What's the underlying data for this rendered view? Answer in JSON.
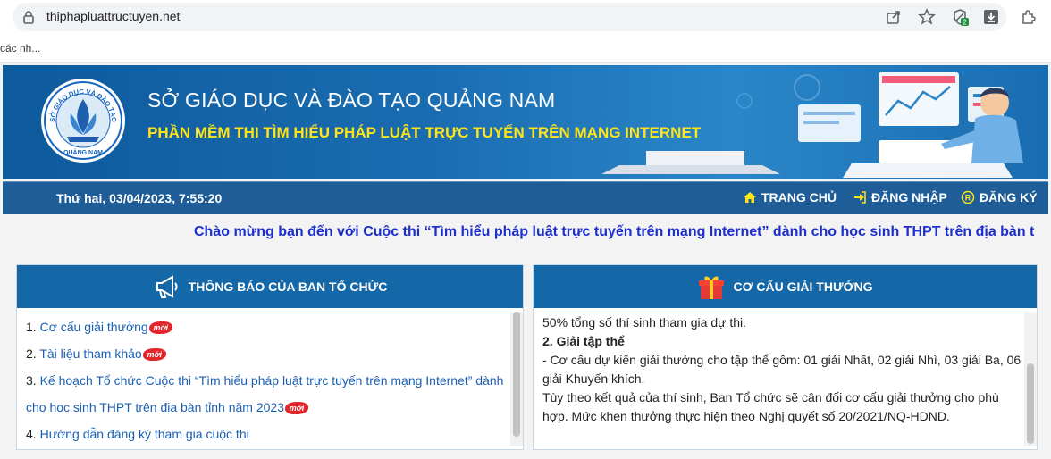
{
  "browser": {
    "url": "thiphapluattructuyen.net",
    "bookmark": "các nh...",
    "extension_badge": "2"
  },
  "header": {
    "org_title": "SỞ GIÁO DỤC VÀ ĐÀO TẠO QUẢNG NAM",
    "app_title": "PHẦN MỀM THI TÌM HIỂU PHÁP LUẬT TRỰC TUYẾN TRÊN MẠNG INTERNET",
    "logo_top": "SỞ GIÁO DỤC VÀ ĐÀO TẠO",
    "logo_bottom": "QUẢNG NAM"
  },
  "nav": {
    "datetime": "Thứ hai, 03/04/2023, 7:55:20",
    "home": "TRANG CHỦ",
    "login": "ĐĂNG NHẬP",
    "register": "ĐĂNG KÝ"
  },
  "marquee": "Chào mừng bạn đến với Cuộc thi “Tìm hiểu pháp luật trực tuyến trên mạng Internet” dành cho học sinh THPT trên địa bàn t",
  "notices": {
    "title": "THÔNG BÁO CỦA BAN TỔ CHỨC",
    "new_label": "mới",
    "items": [
      {
        "num": "1. ",
        "text": "Cơ cấu giải thưởng"
      },
      {
        "num": "2. ",
        "text": "Tài liệu tham khảo"
      },
      {
        "num": "3. ",
        "text": "Kế hoạch Tổ chức Cuộc thi “Tìm hiểu pháp luật trực tuyến trên mạng Internet” dành cho học sinh THPT trên địa bàn tỉnh năm 2023"
      },
      {
        "num": "4. ",
        "text": "Hướng dẫn đăng ký tham gia cuộc thi"
      }
    ]
  },
  "prizes": {
    "title": "CƠ CẤU GIẢI THƯỞNG",
    "line1": "50% tổng số thí sinh tham gia dự thi.",
    "line2": "2. Giải tập thể",
    "line3": "- Cơ cấu dự kiến giải thưởng cho tập thể gồm: 01 giải Nhất, 02 giải Nhì, 03 giải Ba, 06 giải Khuyến khích.",
    "line4": "Tùy theo kết quả của thí sinh, Ban Tổ chức sẽ cân đối cơ cấu giải thưởng cho phù hợp. Mức khen thưởng thực hiện theo Nghị quyết số 20/2021/NQ-HDND."
  },
  "colors": {
    "banner": "#1a6cb0",
    "navbar": "#1f5d98",
    "panel_header": "#1568a8",
    "app_title": "#ffe41a",
    "marquee": "#1c2fcc",
    "link": "#1a5fb4",
    "badge": "#e2262b"
  }
}
